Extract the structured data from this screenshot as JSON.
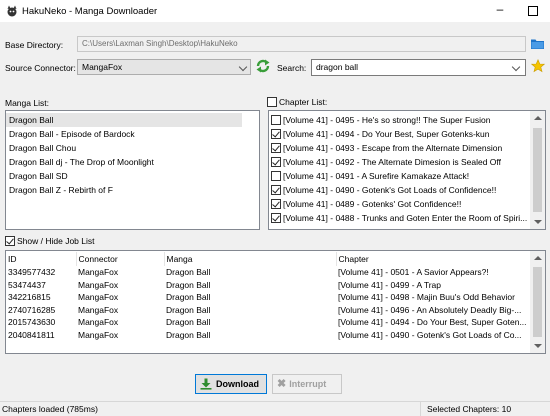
{
  "window": {
    "title": "HakuNeko - Manga Downloader",
    "minimize_label": "–"
  },
  "base_directory": {
    "label": "Base Directory:",
    "value": "C:\\Users\\Laxman Singh\\Desktop\\HakuNeko"
  },
  "source_connector": {
    "label": "Source Connector:",
    "value": "MangaFox"
  },
  "search": {
    "label": "Search:",
    "value": "dragon ball"
  },
  "manga_list": {
    "label": "Manga List:",
    "items": [
      "Dragon Ball",
      "Dragon Ball - Episode of Bardock",
      "Dragon Ball Chou",
      "Dragon Ball dj - The Drop of Moonlight",
      "Dragon Ball SD",
      "Dragon Ball Z - Rebirth of F"
    ],
    "selected_index": 0
  },
  "chapter_list": {
    "label": "Chapter List:",
    "items": [
      {
        "text": "[Volume 41] - 0495 - He's so strong!! The Super Fusion",
        "checked": false
      },
      {
        "text": "[Volume 41] - 0494 - Do Your Best, Super Gotenks-kun",
        "checked": true
      },
      {
        "text": "[Volume 41] - 0493 - Escape from the Alternate Dimension",
        "checked": true
      },
      {
        "text": "[Volume 41] - 0492 - The Alternate Dimesion is Sealed Off",
        "checked": true
      },
      {
        "text": "[Volume 41] - 0491 - A Surefire Kamakaze Attack!",
        "checked": false
      },
      {
        "text": "[Volume 41] - 0490 - Gotenk's Got Loads of Confidence!!",
        "checked": true
      },
      {
        "text": "[Volume 41] - 0489 - Gotenks' Got Confidence!!",
        "checked": true
      },
      {
        "text": "[Volume 41] - 0488 - Trunks and Goten Enter the Room of Spiri...",
        "checked": true
      }
    ]
  },
  "job_list": {
    "toggle_label": "Show / Hide Job List",
    "toggle_checked": true,
    "columns": [
      "ID",
      "Connector",
      "Manga",
      "Chapter"
    ],
    "rows": [
      [
        "3349577432",
        "MangaFox",
        "Dragon Ball",
        "[Volume 41] - 0501 - A Savior Appears?!"
      ],
      [
        "53474437",
        "MangaFox",
        "Dragon Ball",
        "[Volume 41] - 0499 - A Trap"
      ],
      [
        "342216815",
        "MangaFox",
        "Dragon Ball",
        "[Volume 41] - 0498 - Majin Buu's Odd Behavior"
      ],
      [
        "2740716285",
        "MangaFox",
        "Dragon Ball",
        "[Volume 41] - 0496 - An Absolutely Deadly Big-..."
      ],
      [
        "2015743630",
        "MangaFox",
        "Dragon Ball",
        "[Volume 41] - 0494 - Do Your Best, Super Goten..."
      ],
      [
        "2040841811",
        "MangaFox",
        "Dragon Ball",
        "[Volume 41] - 0490 - Gotenk's Got Loads of Co..."
      ]
    ]
  },
  "buttons": {
    "download": "Download",
    "interrupt": "Interrupt"
  },
  "status": {
    "left": "Chapters loaded (785ms)",
    "right": "Selected Chapters: 10"
  },
  "colors": {
    "accent": "#0078d7",
    "download_green": "#2e8b2e",
    "folder_blue": "#1e73c8",
    "refresh_green": "#3a9e3a",
    "star_yellow": "#f5c400"
  },
  "icons": [
    "app-icon",
    "folder-icon",
    "refresh-icon",
    "star-icon",
    "download-icon",
    "interrupt-icon"
  ]
}
